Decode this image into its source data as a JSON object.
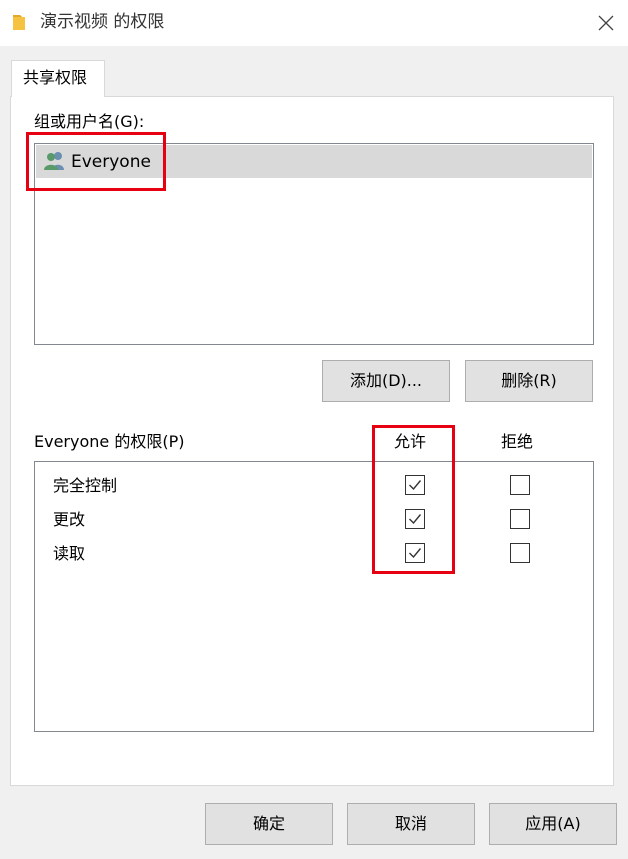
{
  "window": {
    "title": "演示视频 的权限",
    "folder_icon": "folder-icon",
    "close_icon": "close-icon"
  },
  "tabs": [
    {
      "label": "共享权限",
      "active": true
    }
  ],
  "group_section": {
    "label": "组或用户名(G):",
    "items": [
      {
        "name": "Everyone",
        "icon": "users-icon",
        "selected": true
      }
    ],
    "add_button": "添加(D)...",
    "remove_button": "删除(R)"
  },
  "permissions": {
    "label": "Everyone 的权限(P)",
    "allow_header": "允许",
    "deny_header": "拒绝",
    "rows": [
      {
        "name": "完全控制",
        "allow": true,
        "deny": false
      },
      {
        "name": "更改",
        "allow": true,
        "deny": false
      },
      {
        "name": "读取",
        "allow": true,
        "deny": false
      }
    ]
  },
  "footer": {
    "ok": "确定",
    "cancel": "取消",
    "apply": "应用(A)"
  },
  "colors": {
    "highlight": "#e60012",
    "selection": "#d9d9d9",
    "button_bg": "#e1e1e1"
  }
}
